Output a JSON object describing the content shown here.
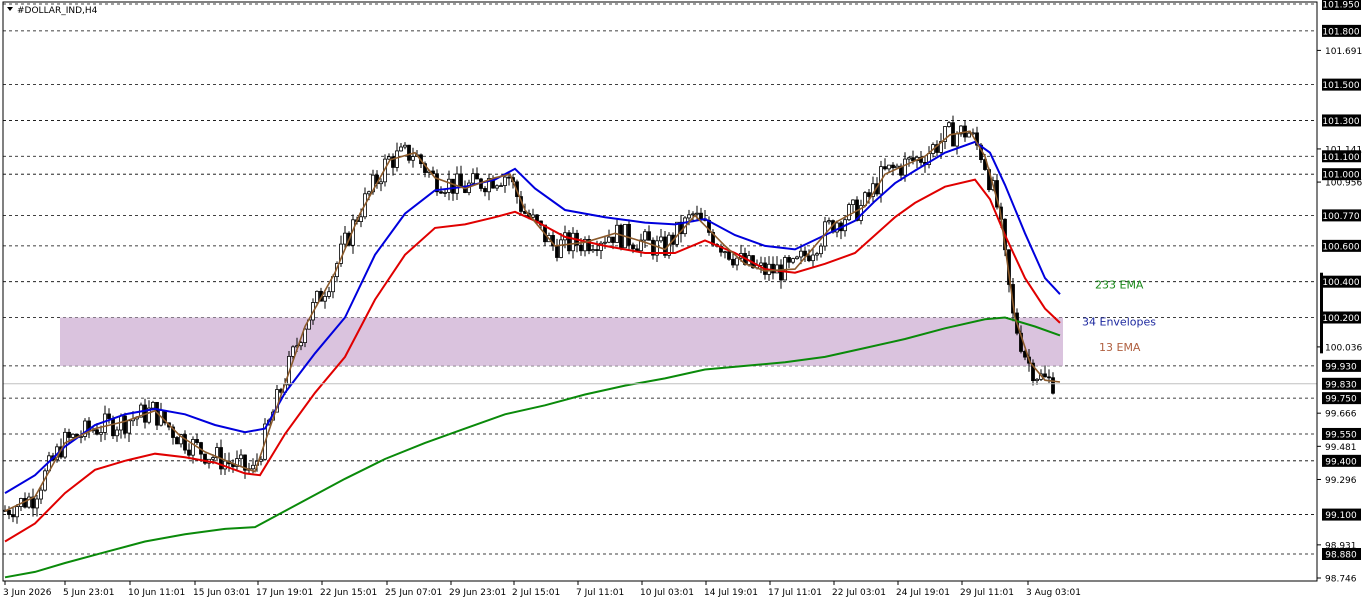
{
  "chart_data": {
    "type": "candlestick",
    "title": "#DOLLAR_IND,H4",
    "ylim": [
      98.746,
      101.95
    ],
    "x_ticks": [
      "3 Jun 2026",
      "5 Jun 23:01",
      "10 Jun 11:01",
      "15 Jun 03:01",
      "17 Jun 19:01",
      "22 Jun 15:01",
      "25 Jun 07:01",
      "29 Jun 23:01",
      "2 Jul 15:01",
      "7 Jul 11:01",
      "10 Jul 03:01",
      "14 Jul 19:01",
      "17 Jul 11:01",
      "22 Jul 03:01",
      "24 Jul 19:01",
      "29 Jul 11:01",
      "3 Aug 03:01"
    ],
    "y_scale_ticks": [
      101.95,
      101.691,
      101.141,
      100.956,
      100.036,
      99.666,
      99.481,
      99.296,
      98.931,
      98.746
    ],
    "level_lines": [
      101.95,
      101.8,
      101.5,
      101.3,
      101.1,
      101.0,
      100.77,
      100.6,
      100.4,
      100.2,
      99.93,
      99.75,
      99.55,
      99.4,
      99.1,
      98.88
    ],
    "current_price": 99.83,
    "zone": {
      "low": 99.93,
      "high": 100.2
    },
    "annotations": [
      {
        "text": "233 EMA",
        "color": "#1a8a1a"
      },
      {
        "text": "34 Envelopes",
        "color": "#1e2aa0"
      },
      {
        "text": "13 EMA",
        "color": "#b06040"
      }
    ],
    "series": [
      {
        "name": "233 EMA",
        "color": "#0a8a0a",
        "points": [
          [
            0,
            98.75
          ],
          [
            30,
            98.78
          ],
          [
            60,
            98.83
          ],
          [
            100,
            98.89
          ],
          [
            140,
            98.95
          ],
          [
            180,
            98.99
          ],
          [
            220,
            99.02
          ],
          [
            250,
            99.03
          ],
          [
            270,
            99.09
          ],
          [
            300,
            99.18
          ],
          [
            340,
            99.3
          ],
          [
            380,
            99.41
          ],
          [
            420,
            99.5
          ],
          [
            460,
            99.58
          ],
          [
            500,
            99.66
          ],
          [
            540,
            99.71
          ],
          [
            580,
            99.77
          ],
          [
            620,
            99.82
          ],
          [
            660,
            99.86
          ],
          [
            700,
            99.91
          ],
          [
            740,
            99.93
          ],
          [
            780,
            99.95
          ],
          [
            820,
            99.98
          ],
          [
            860,
            100.03
          ],
          [
            900,
            100.08
          ],
          [
            940,
            100.14
          ],
          [
            980,
            100.19
          ],
          [
            1000,
            100.2
          ],
          [
            1030,
            100.15
          ],
          [
            1055,
            100.1
          ]
        ]
      },
      {
        "name": "34 Envelopes",
        "color": "#0000dd",
        "points": [
          [
            0,
            99.22
          ],
          [
            30,
            99.32
          ],
          [
            60,
            99.48
          ],
          [
            90,
            99.6
          ],
          [
            120,
            99.66
          ],
          [
            150,
            99.69
          ],
          [
            180,
            99.66
          ],
          [
            210,
            99.6
          ],
          [
            240,
            99.56
          ],
          [
            260,
            99.58
          ],
          [
            280,
            99.78
          ],
          [
            310,
            100.0
          ],
          [
            340,
            100.2
          ],
          [
            370,
            100.55
          ],
          [
            400,
            100.78
          ],
          [
            430,
            100.91
          ],
          [
            460,
            100.93
          ],
          [
            490,
            100.97
          ],
          [
            510,
            101.03
          ],
          [
            530,
            100.92
          ],
          [
            560,
            100.8
          ],
          [
            600,
            100.76
          ],
          [
            640,
            100.73
          ],
          [
            670,
            100.72
          ],
          [
            700,
            100.75
          ],
          [
            730,
            100.66
          ],
          [
            760,
            100.6
          ],
          [
            790,
            100.58
          ],
          [
            820,
            100.66
          ],
          [
            850,
            100.74
          ],
          [
            870,
            100.85
          ],
          [
            890,
            100.95
          ],
          [
            910,
            101.02
          ],
          [
            940,
            101.12
          ],
          [
            970,
            101.18
          ],
          [
            985,
            101.12
          ],
          [
            1000,
            100.94
          ],
          [
            1020,
            100.67
          ],
          [
            1040,
            100.42
          ],
          [
            1055,
            100.33
          ]
        ]
      },
      {
        "name": "Red EMA",
        "color": "#e00000",
        "points": [
          [
            0,
            98.95
          ],
          [
            30,
            99.05
          ],
          [
            60,
            99.22
          ],
          [
            90,
            99.35
          ],
          [
            120,
            99.4
          ],
          [
            150,
            99.44
          ],
          [
            180,
            99.42
          ],
          [
            210,
            99.39
          ],
          [
            240,
            99.33
          ],
          [
            255,
            99.32
          ],
          [
            280,
            99.55
          ],
          [
            310,
            99.78
          ],
          [
            340,
            99.98
          ],
          [
            370,
            100.3
          ],
          [
            400,
            100.55
          ],
          [
            430,
            100.7
          ],
          [
            460,
            100.72
          ],
          [
            490,
            100.76
          ],
          [
            510,
            100.79
          ],
          [
            530,
            100.74
          ],
          [
            560,
            100.65
          ],
          [
            600,
            100.6
          ],
          [
            640,
            100.56
          ],
          [
            670,
            100.56
          ],
          [
            700,
            100.63
          ],
          [
            730,
            100.56
          ],
          [
            760,
            100.47
          ],
          [
            790,
            100.45
          ],
          [
            820,
            100.5
          ],
          [
            850,
            100.56
          ],
          [
            870,
            100.66
          ],
          [
            890,
            100.76
          ],
          [
            910,
            100.84
          ],
          [
            940,
            100.93
          ],
          [
            970,
            100.97
          ],
          [
            985,
            100.86
          ],
          [
            1000,
            100.66
          ],
          [
            1020,
            100.42
          ],
          [
            1040,
            100.25
          ],
          [
            1055,
            100.17
          ]
        ]
      },
      {
        "name": "13 EMA",
        "color": "#8b5a2b",
        "points": [
          [
            0,
            99.12
          ],
          [
            30,
            99.2
          ],
          [
            60,
            99.5
          ],
          [
            90,
            99.58
          ],
          [
            120,
            99.62
          ],
          [
            150,
            99.68
          ],
          [
            175,
            99.54
          ],
          [
            200,
            99.45
          ],
          [
            230,
            99.38
          ],
          [
            250,
            99.34
          ],
          [
            275,
            99.75
          ],
          [
            300,
            100.15
          ],
          [
            330,
            100.45
          ],
          [
            355,
            100.78
          ],
          [
            385,
            101.08
          ],
          [
            410,
            101.12
          ],
          [
            430,
            100.98
          ],
          [
            460,
            100.92
          ],
          [
            490,
            100.98
          ],
          [
            505,
            101.0
          ],
          [
            520,
            100.8
          ],
          [
            550,
            100.6
          ],
          [
            580,
            100.62
          ],
          [
            610,
            100.67
          ],
          [
            640,
            100.62
          ],
          [
            660,
            100.58
          ],
          [
            690,
            100.77
          ],
          [
            720,
            100.6
          ],
          [
            740,
            100.5
          ],
          [
            760,
            100.46
          ],
          [
            790,
            100.47
          ],
          [
            810,
            100.6
          ],
          [
            830,
            100.73
          ],
          [
            860,
            100.82
          ],
          [
            880,
            101.0
          ],
          [
            900,
            101.05
          ],
          [
            920,
            101.1
          ],
          [
            945,
            101.22
          ],
          [
            965,
            101.24
          ],
          [
            980,
            101.1
          ],
          [
            995,
            100.8
          ],
          [
            1010,
            100.2
          ],
          [
            1025,
            99.95
          ],
          [
            1040,
            99.85
          ],
          [
            1055,
            99.84
          ]
        ]
      }
    ]
  }
}
